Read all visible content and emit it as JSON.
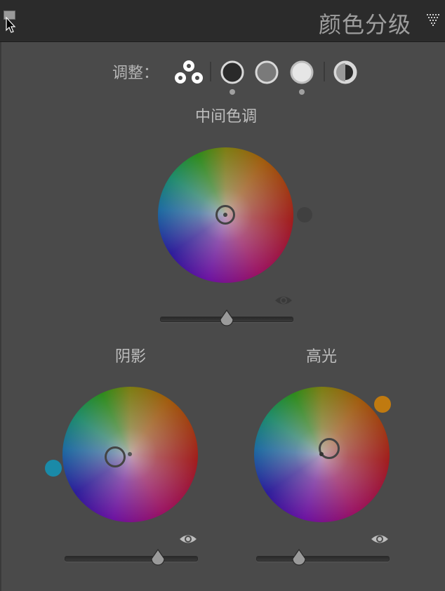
{
  "header": {
    "title": "颜色分级",
    "collapse_icon": "collapse-square-icon",
    "menu_icon": "triangle-menu-icon"
  },
  "adjust": {
    "label": "调整：",
    "buttons": [
      {
        "name": "three-way-icon",
        "selected": true
      },
      {
        "name": "shadows-icon"
      },
      {
        "name": "midtones-icon"
      },
      {
        "name": "highlights-icon"
      },
      {
        "name": "global-icon"
      }
    ]
  },
  "midtones": {
    "label": "中间色调"
  },
  "shadows": {
    "label": "阴影",
    "tint_color": "#1a8aa8"
  },
  "highlights": {
    "label": "高光",
    "tint_color": "#c07a10"
  },
  "sliders": {
    "midtones_luminance": 0.5,
    "shadows_luminance": 0.7,
    "highlights_luminance": 0.32
  },
  "colors": {
    "panel_bg": "#4a4a4a",
    "header_bg": "#2b2b2b",
    "accent_shadow_dot": "#1a8aa8",
    "accent_highlight_dot": "#c07a10"
  }
}
